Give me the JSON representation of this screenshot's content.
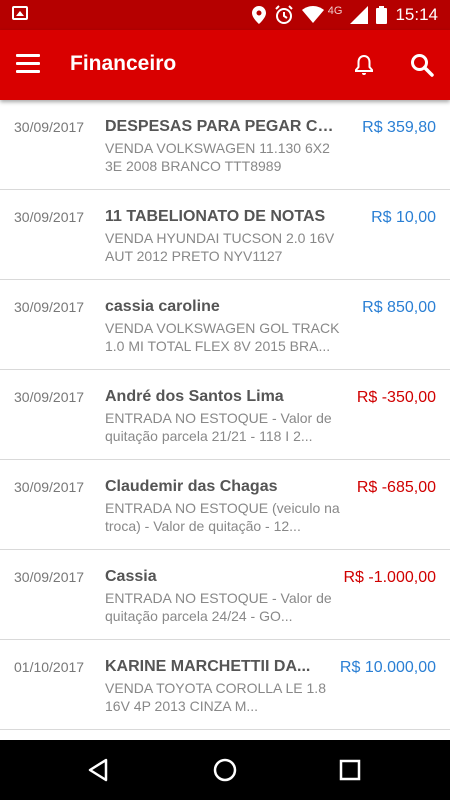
{
  "status_bar": {
    "network": "4G",
    "time": "15:14",
    "icons": [
      "image-icon",
      "location-icon",
      "alarm-icon",
      "wifi-icon",
      "signal-icon",
      "battery-icon"
    ]
  },
  "app_bar": {
    "title": "Financeiro",
    "icons": [
      "menu-icon",
      "bell-icon",
      "search-icon"
    ],
    "color": "#d90000"
  },
  "transactions": [
    {
      "date": "30/09/2017",
      "name": "DESPESAS PARA PEGAR CA...",
      "amount": "R$ 359,80",
      "type": "positive",
      "description": "VENDA VOLKSWAGEN 11.130 6X2 3E  2008 BRANCO TTT8989"
    },
    {
      "date": "30/09/2017",
      "name": "11  TABELIONATO DE NOTAS",
      "amount": "R$ 10,00",
      "type": "positive",
      "description": "VENDA HYUNDAI TUCSON 2.0 16V AUT 2012 PRETO NYV1127"
    },
    {
      "date": "30/09/2017",
      "name": "cassia caroline",
      "amount": "R$ 850,00",
      "type": "positive",
      "description": "VENDA VOLKSWAGEN GOL TRACK 1.0 MI TOTAL FLEX 8V 2015 BRA..."
    },
    {
      "date": "30/09/2017",
      "name": "André dos Santos Lima",
      "amount": "R$ -350,00",
      "type": "negative",
      "description": "ENTRADA NO ESTOQUE - Valor de quitação parcela 21/21 - 118 I 2..."
    },
    {
      "date": "30/09/2017",
      "name": "Claudemir das Chagas",
      "amount": "R$ -685,00",
      "type": "negative",
      "description": "ENTRADA NO ESTOQUE (veiculo na troca) - Valor de quitação - 12..."
    },
    {
      "date": "30/09/2017",
      "name": "Cassia",
      "amount": "R$ -1.000,00",
      "type": "negative",
      "description": "ENTRADA NO ESTOQUE - Valor de quitação parcela 24/24 - GO..."
    },
    {
      "date": "01/10/2017",
      "name": "KARINE MARCHETTII DA...",
      "amount": "R$ 10.000,00",
      "type": "positive",
      "description": "VENDA TOYOTA COROLLA LE 1.8 16V 4P  2013 CINZA M..."
    }
  ],
  "colors": {
    "positive": "#2a7fd4",
    "negative": "#d00000"
  },
  "nav_bar": {
    "icons": [
      "back-icon",
      "home-icon",
      "recents-icon"
    ]
  }
}
